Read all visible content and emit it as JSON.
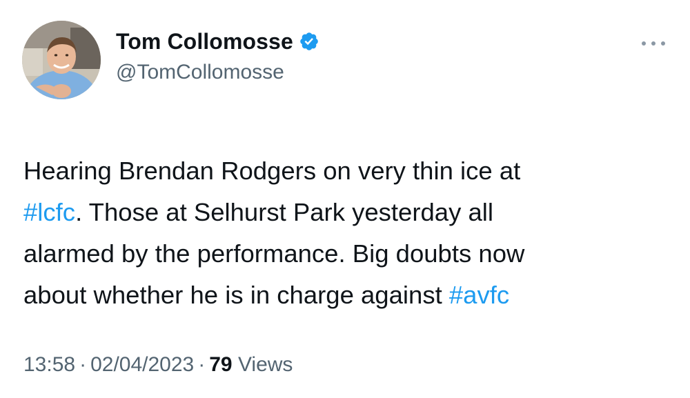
{
  "author": {
    "display_name": "Tom Collomosse",
    "handle": "@TomCollomosse",
    "verified": true,
    "verified_color": "#1d9bf0",
    "avatar_icon": "profile-photo"
  },
  "more_icon": "ellipsis-icon",
  "tweet": {
    "line1": "Hearing Brendan Rodgers on very thin ice at",
    "hashtag1": "#lcfc",
    "line2_rest": ". Those at Selhurst Park yesterday all",
    "line3": "alarmed by the performance. Big doubts now",
    "line4": "about whether he is in charge against ",
    "hashtag2": "#avfc"
  },
  "meta": {
    "time": "13:58",
    "separator": "·",
    "date": "02/04/2023",
    "views_count": "79",
    "views_label": "Views"
  },
  "colors": {
    "text": "#0f1419",
    "secondary": "#536471",
    "link": "#1d9bf0",
    "background": "#ffffff"
  }
}
